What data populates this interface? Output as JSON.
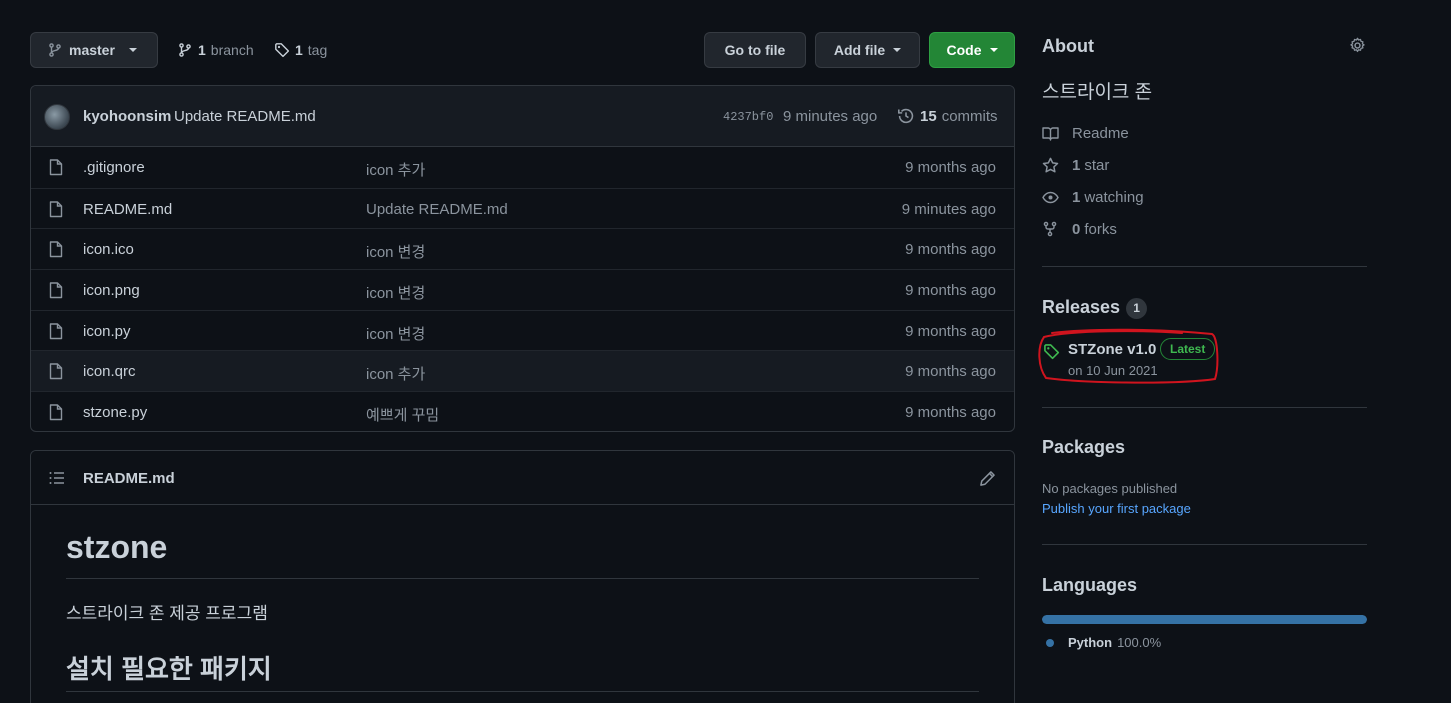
{
  "toolbar": {
    "branch_label": "master",
    "branches_count": "1",
    "branches_label": "branch",
    "tags_count": "1",
    "tags_label": "tag",
    "go_to_file": "Go to file",
    "add_file": "Add file",
    "code": "Code"
  },
  "commit": {
    "author": "kyohoonsim",
    "message": "Update README.md",
    "sha": "4237bf0",
    "time": "9 minutes ago",
    "commits_count": "15",
    "commits_label": "commits"
  },
  "files": [
    {
      "name": ".gitignore",
      "message": "icon 추가",
      "time": "9 months ago"
    },
    {
      "name": "README.md",
      "message": "Update README.md",
      "time": "9 minutes ago"
    },
    {
      "name": "icon.ico",
      "message": "icon 변경",
      "time": "9 months ago"
    },
    {
      "name": "icon.png",
      "message": "icon 변경",
      "time": "9 months ago"
    },
    {
      "name": "icon.py",
      "message": "icon 변경",
      "time": "9 months ago"
    },
    {
      "name": "icon.qrc",
      "message": "icon 추가",
      "time": "9 months ago"
    },
    {
      "name": "stzone.py",
      "message": "예쁘게 꾸밈",
      "time": "9 months ago"
    }
  ],
  "readme": {
    "filename": "README.md",
    "h1": "stzone",
    "paragraph": "스트라이크 존 제공 프로그램",
    "h2": "설치 필요한 패키지"
  },
  "about": {
    "heading": "About",
    "description": "스트라이크 존",
    "readme_label": "Readme",
    "stars_count": "1",
    "stars_label": "star",
    "watching_count": "1",
    "watching_label": "watching",
    "forks_count": "0",
    "forks_label": "forks"
  },
  "releases": {
    "heading": "Releases",
    "count": "1",
    "name": "STZone v1.0",
    "badge": "Latest",
    "date": "on 10 Jun 2021"
  },
  "packages": {
    "heading": "Packages",
    "note": "No packages published",
    "link": "Publish your first package"
  },
  "languages": {
    "heading": "Languages",
    "items": [
      {
        "name": "Python",
        "percent": "100.0%",
        "fraction": 1.0,
        "color": "#3572A5"
      }
    ]
  },
  "colors": {
    "annotation_circle": "#d0141e",
    "accent_green": "#238636",
    "link_blue": "#58a6ff"
  }
}
